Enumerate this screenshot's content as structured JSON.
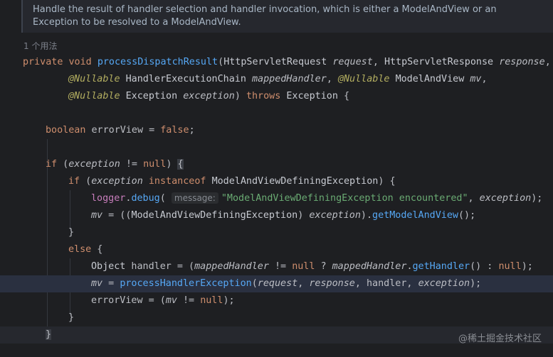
{
  "doc": {
    "line1": "Handle the result of handler selection and handler invocation, which is either a ModelAndView or an",
    "line2": "Exception to be resolved to a ModelAndView."
  },
  "usages": "1 个用法",
  "code": {
    "l1": {
      "kw1": "private",
      "kw2": "void",
      "fn": "processDispatchResult",
      "p1": "(",
      "t1": "HttpServletRequest",
      "a1": "request",
      "c1": ", ",
      "t2": "HttpServletResponse",
      "a2": "response",
      "c2": ","
    },
    "l2": {
      "an1": "@Nullable",
      "t1": "HandlerExecutionChain",
      "a1": "mappedHandler",
      "c1": ", ",
      "an2": "@Nullable",
      "t2": "ModelAndView",
      "a2": "mv",
      "c2": ","
    },
    "l3": {
      "an1": "@Nullable",
      "t1": "Exception",
      "a1": "exception",
      "p1": ") ",
      "kw1": "throws",
      "t2": "Exception",
      "br": "{"
    },
    "l4": {
      "kw1": "boolean",
      "v1": "errorView",
      "op": " = ",
      "kw2": "false",
      "end": ";"
    },
    "l5": {
      "kw1": "if",
      "p1": " (",
      "a1": "exception",
      "op": " != ",
      "kw2": "null",
      "p2": ") ",
      "br": "{"
    },
    "l6": {
      "kw1": "if",
      "p1": " (",
      "a1": "exception",
      "kw2": "instanceof",
      "t1": "ModelAndViewDefiningException",
      "p2": ") {"
    },
    "l7": {
      "v1": "logger",
      "dot": ".",
      "fn": "debug",
      "p1": "(",
      "hint": "message:",
      "st": "\"ModelAndViewDefiningException encountered\"",
      "c1": ", ",
      "a1": "exception",
      "end": ");"
    },
    "l8": {
      "v1": "mv",
      "op": " = ((",
      "t1": "ModelAndViewDefiningException",
      "p1": ") ",
      "a1": "exception",
      "p2": ").",
      "fn": "getModelAndView",
      "end": "();"
    },
    "l9": {
      "br": "}"
    },
    "l10": {
      "kw1": "else",
      "br": " {"
    },
    "l11": {
      "t1": "Object",
      "v1": " handler = (",
      "a1": "mappedHandler",
      "op": " != ",
      "kw1": "null",
      "q": " ? ",
      "a2": "mappedHandler",
      "dot": ".",
      "fn": "getHandler",
      "p1": "() : ",
      "kw2": "null",
      "end": ");"
    },
    "l12": {
      "a0": "mv",
      "op": " = ",
      "fn": "processHandlerException",
      "p1": "(",
      "a1": "request",
      "c1": ", ",
      "a2": "response",
      "c2": ", handler, ",
      "a3": "exception",
      "end": ");"
    },
    "l13": {
      "v1": "errorView = (",
      "a1": "mv",
      "op": " != ",
      "kw1": "null",
      "end": ");"
    },
    "l14": {
      "br": "}"
    },
    "l15": {
      "br": "}"
    }
  },
  "watermark": "@稀土掘金技术社区"
}
